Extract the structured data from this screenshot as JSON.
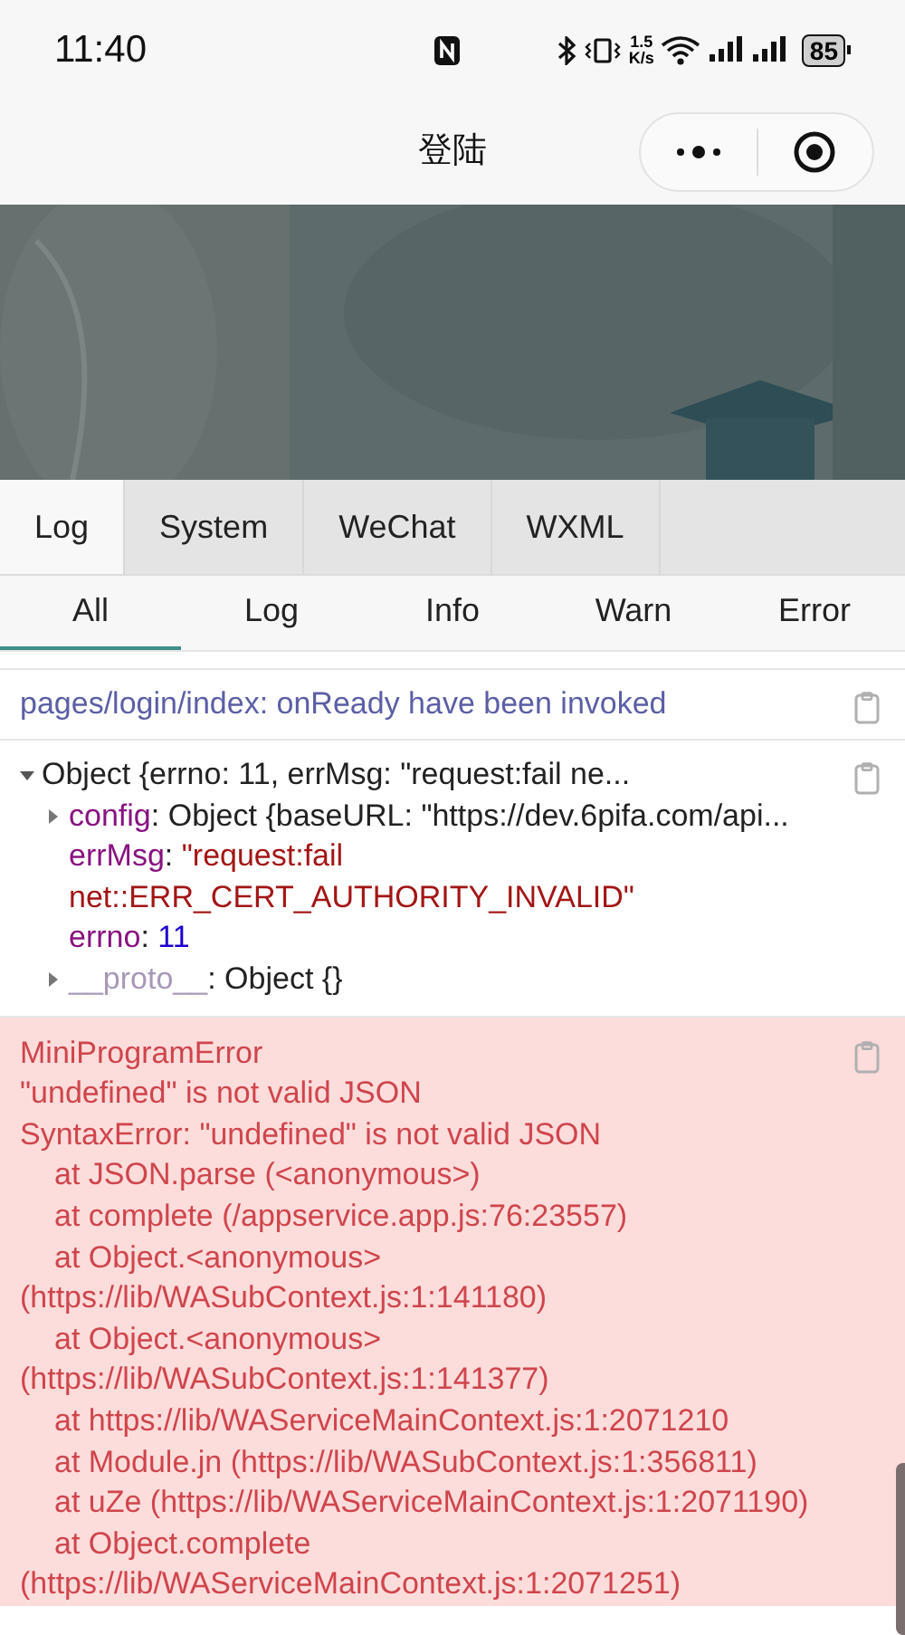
{
  "status_bar": {
    "time": "11:40",
    "speed_value": "1.5",
    "speed_unit": "K/s",
    "battery": "85"
  },
  "nav": {
    "title": "登陆"
  },
  "tabs": [
    {
      "label": "Log",
      "selected": true
    },
    {
      "label": "System",
      "selected": false
    },
    {
      "label": "WeChat",
      "selected": false
    },
    {
      "label": "WXML",
      "selected": false
    }
  ],
  "filters": [
    {
      "label": "All",
      "selected": true
    },
    {
      "label": "Log",
      "selected": false
    },
    {
      "label": "Info",
      "selected": false
    },
    {
      "label": "Warn",
      "selected": false
    },
    {
      "label": "Error",
      "selected": false
    }
  ],
  "logs": [
    {
      "kind": "info",
      "text": "pages/login/index: onReady have been invoked"
    },
    {
      "kind": "object",
      "summary": "Object {errno: 11, errMsg: \"request:fail ne...",
      "expanded": true,
      "props": [
        {
          "kind": "object",
          "key": "config",
          "sep": ":",
          "value": "Object {baseURL: \"https://dev.6pifa.com/api...",
          "expanded": false
        },
        {
          "kind": "string",
          "key": "errMsg",
          "sep": ":",
          "value": "\"request:fail net::ERR_CERT_AUTHORITY_INVALID\""
        },
        {
          "kind": "number",
          "key": "errno",
          "sep": ":",
          "value": "11"
        },
        {
          "kind": "proto",
          "key": "__proto__",
          "sep": ":",
          "value": "Object {}",
          "expanded": false
        }
      ]
    },
    {
      "kind": "error",
      "lines": [
        {
          "kind": "message",
          "text": "MiniProgramError"
        },
        {
          "kind": "message",
          "text": "\"undefined\" is not valid JSON"
        },
        {
          "kind": "message",
          "text": "SyntaxError: \"undefined\" is not valid JSON"
        },
        {
          "kind": "frame",
          "text": "at JSON.parse (<anonymous>)"
        },
        {
          "kind": "frame",
          "text": "at complete (/appservice.app.js:76:23557)"
        },
        {
          "kind": "frame",
          "text": "at Object.<anonymous>"
        },
        {
          "kind": "message",
          "text": "(https://lib/WASubContext.js:1:141180)"
        },
        {
          "kind": "frame",
          "text": "at Object.<anonymous>"
        },
        {
          "kind": "message",
          "text": "(https://lib/WASubContext.js:1:141377)"
        },
        {
          "kind": "frame",
          "text": "at https://lib/WAServiceMainContext.js:1:2071210"
        },
        {
          "kind": "frame",
          "text": "at Module.jn (https://lib/WASubContext.js:1:356811)"
        },
        {
          "kind": "frame",
          "text": "at uZe (https://lib/WAServiceMainContext.js:1:2071190)"
        },
        {
          "kind": "frame",
          "text": "at Object.complete"
        },
        {
          "kind": "message",
          "text": "(https://lib/WAServiceMainContext.js:1:2071251)"
        }
      ]
    }
  ]
}
